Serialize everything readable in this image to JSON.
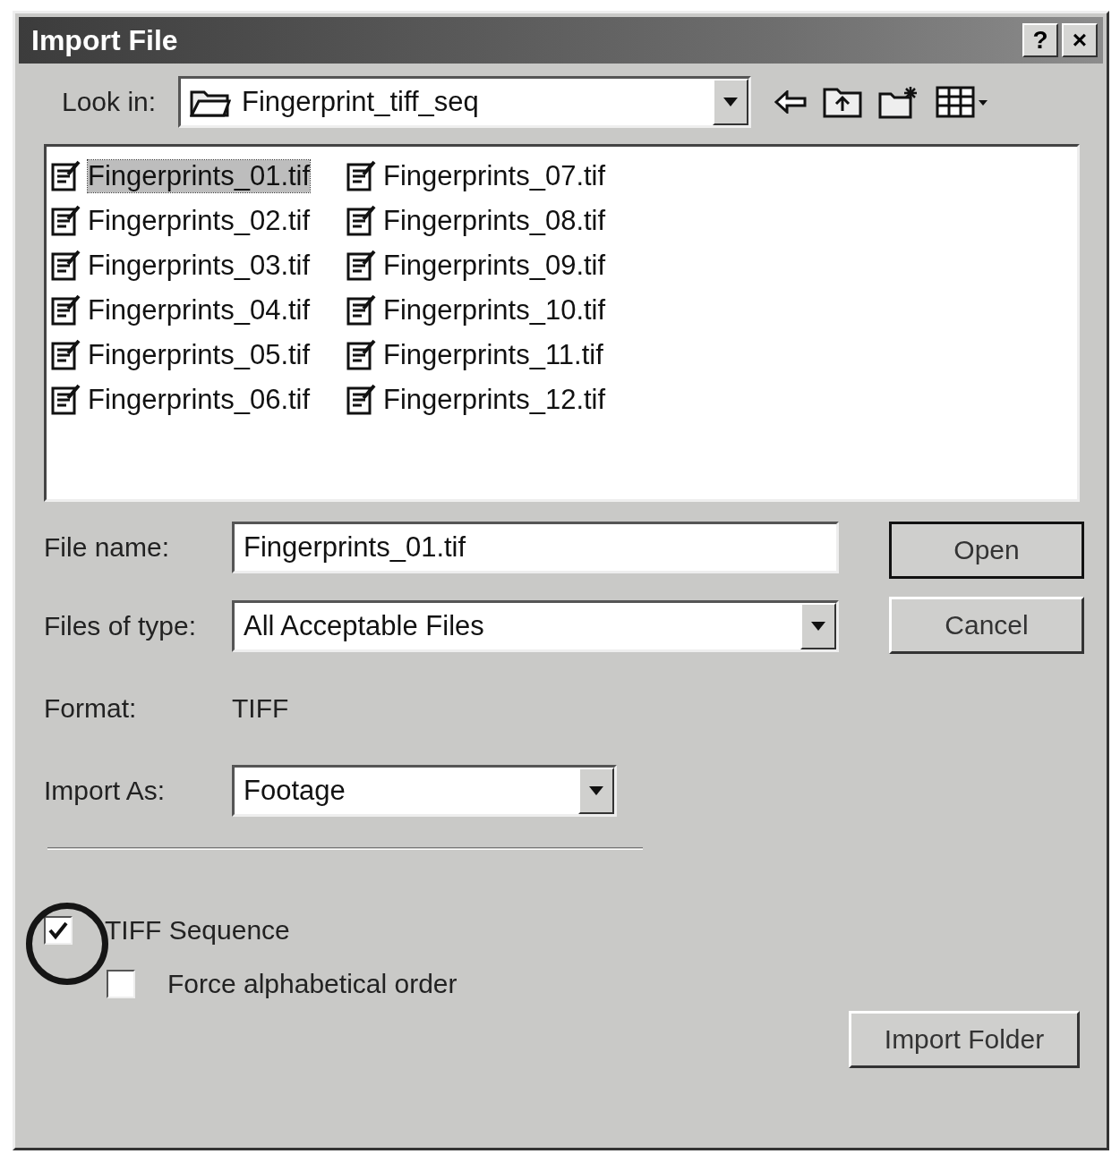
{
  "window": {
    "title": "Import File",
    "buttons": [
      {
        "label": "?"
      },
      {
        "label": "×"
      }
    ]
  },
  "look_in": {
    "label": "Look in:",
    "value": "Fingerprint_tiff_seq"
  },
  "files": [
    {
      "name": "Fingerprints_01.tif",
      "selected": true
    },
    {
      "name": "Fingerprints_02.tif",
      "selected": false
    },
    {
      "name": "Fingerprints_03.tif",
      "selected": false
    },
    {
      "name": "Fingerprints_04.tif",
      "selected": false
    },
    {
      "name": "Fingerprints_05.tif",
      "selected": false
    },
    {
      "name": "Fingerprints_06.tif",
      "selected": false
    },
    {
      "name": "Fingerprints_07.tif",
      "selected": false
    },
    {
      "name": "Fingerprints_08.tif",
      "selected": false
    },
    {
      "name": "Fingerprints_09.tif",
      "selected": false
    },
    {
      "name": "Fingerprints_10.tif",
      "selected": false
    },
    {
      "name": "Fingerprints_11.tif",
      "selected": false
    },
    {
      "name": "Fingerprints_12.tif",
      "selected": false
    }
  ],
  "file_name": {
    "label": "File name:",
    "value": "Fingerprints_01.tif"
  },
  "files_of_type": {
    "label": "Files of type:",
    "value": "All Acceptable Files"
  },
  "format": {
    "label": "Format:",
    "value": "TIFF"
  },
  "import_as": {
    "label": "Import As:",
    "value": "Footage"
  },
  "options": [
    {
      "label": "TIFF Sequence",
      "checked": true,
      "children": [
        {
          "label": "Force alphabetical order",
          "checked": false
        }
      ]
    }
  ],
  "buttons": {
    "open": "Open",
    "cancel": "Cancel",
    "import_folder": "Import Folder"
  }
}
